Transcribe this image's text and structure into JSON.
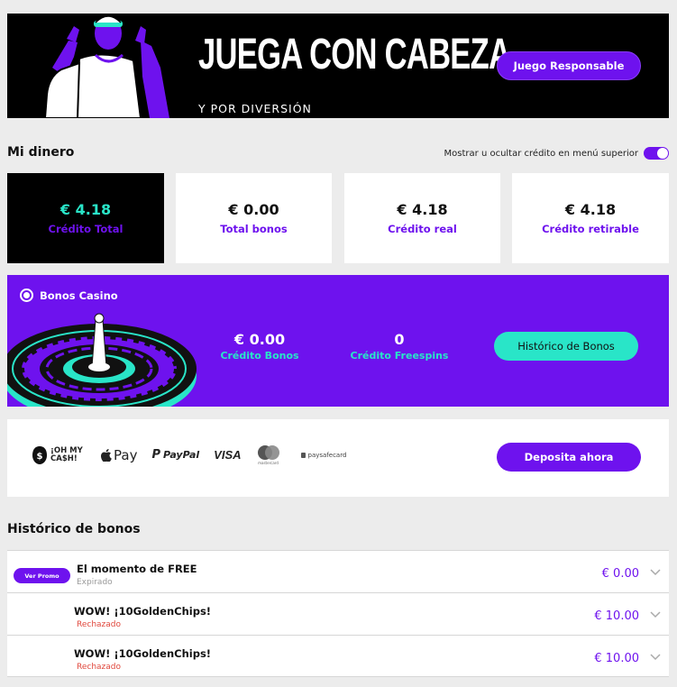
{
  "hero": {
    "title": "JUEGA CON CABEZA",
    "subtitle": "Y POR DIVERSIÓN",
    "button": "Juego Responsable"
  },
  "money": {
    "title": "Mi dinero",
    "toggle_label": "Mostrar u ocultar crédito en menú superior",
    "toggle_on": true,
    "cards": [
      {
        "amount": "€ 4.18",
        "label": "Crédito Total"
      },
      {
        "amount": "€ 0.00",
        "label": "Total bonos"
      },
      {
        "amount": "€ 4.18",
        "label": "Crédito real"
      },
      {
        "amount": "€ 4.18",
        "label": "Crédito retirable"
      }
    ]
  },
  "bonos": {
    "title": "Bonos Casino",
    "stats": [
      {
        "amount": "€ 0.00",
        "label": "Crédito Bonos"
      },
      {
        "amount": "0",
        "label": "Crédito Freespins"
      }
    ],
    "button": "Histórico de Bonos"
  },
  "payments": {
    "logos": {
      "ohmycash": "¡OH MY CA$H!",
      "applepay": "Pay",
      "paypal": "PayPal",
      "visa": "VISA",
      "mastercard": "mastercard",
      "paysafe": "paysafecard"
    },
    "button": "Deposita ahora"
  },
  "history": {
    "title": "Histórico de bonos",
    "promo_button": "Ver Promo",
    "rows": [
      {
        "name": "El momento de FREE",
        "status": "Expirado",
        "amount": "€ 0.00"
      },
      {
        "name": "WOW! ¡10GoldenChips!",
        "status": "Rechazado",
        "amount": "€ 10.00"
      },
      {
        "name": "WOW! ¡10GoldenChips!",
        "status": "Rechazado",
        "amount": "€ 10.00"
      }
    ]
  },
  "colors": {
    "brand_purple": "#6e12ee",
    "teal": "#29e5c8",
    "reject_red": "#e0473c"
  },
  "icons": [
    "roulette-illustration",
    "player-illustration",
    "chevron-down-icon",
    "casino-logo-icon",
    "apple-icon"
  ]
}
